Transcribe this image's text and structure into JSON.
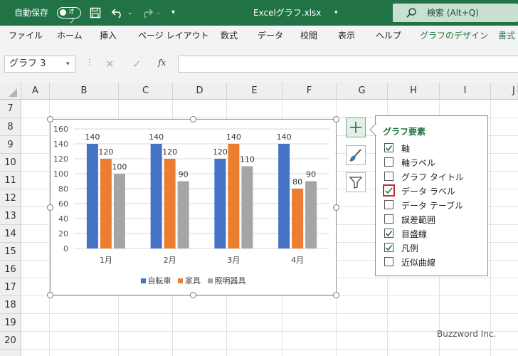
{
  "title_bar": {
    "autosave_label": "自動保存",
    "autosave_state": "オフ",
    "filename": "Excelグラフ.xlsx",
    "search_placeholder": "検索 (Alt+Q)"
  },
  "ribbon_tabs": [
    "ファイル",
    "ホーム",
    "挿入",
    "ページ レイアウト",
    "数式",
    "データ",
    "校閲",
    "表示",
    "ヘルプ",
    "グラフのデザイン",
    "書式"
  ],
  "formula_bar": {
    "name_box": "グラフ 3",
    "fx": "fx"
  },
  "columns": [
    "A",
    "B",
    "C",
    "D",
    "E",
    "F",
    "G",
    "H",
    "I",
    "J"
  ],
  "rows": [
    "7",
    "8",
    "9",
    "10",
    "11",
    "12",
    "13",
    "14",
    "15",
    "16",
    "17",
    "18",
    "19",
    "20"
  ],
  "chart_data": {
    "type": "bar",
    "categories": [
      "1月",
      "2月",
      "3月",
      "4月"
    ],
    "series": [
      {
        "name": "自転車",
        "values": [
          140,
          140,
          120,
          140
        ],
        "color": "#4472c4"
      },
      {
        "name": "家具",
        "values": [
          120,
          120,
          140,
          80
        ],
        "color": "#ed7d31"
      },
      {
        "name": "照明器具",
        "values": [
          100,
          90,
          110,
          90
        ],
        "color": "#a5a5a5"
      }
    ],
    "ylim": [
      0,
      160
    ],
    "yticks": [
      "0",
      "20",
      "40",
      "60",
      "80",
      "100",
      "120",
      "140",
      "160"
    ],
    "grid": true,
    "data_labels": true,
    "legend": "bottom"
  },
  "chart_elements_popup": {
    "title": "グラフ要素",
    "options": [
      {
        "label": "軸",
        "checked": true
      },
      {
        "label": "軸ラベル",
        "checked": false
      },
      {
        "label": "グラフ タイトル",
        "checked": false
      },
      {
        "label": "データ ラベル",
        "checked": true,
        "highlighted": true
      },
      {
        "label": "データ テーブル",
        "checked": false
      },
      {
        "label": "誤差範囲",
        "checked": false
      },
      {
        "label": "目盛線",
        "checked": true
      },
      {
        "label": "凡例",
        "checked": true
      },
      {
        "label": "近似曲線",
        "checked": false
      }
    ]
  },
  "side_buttons": [
    "chart-elements-icon",
    "chart-styles-icon",
    "chart-filters-icon"
  ],
  "watermark": "Buzzword Inc."
}
